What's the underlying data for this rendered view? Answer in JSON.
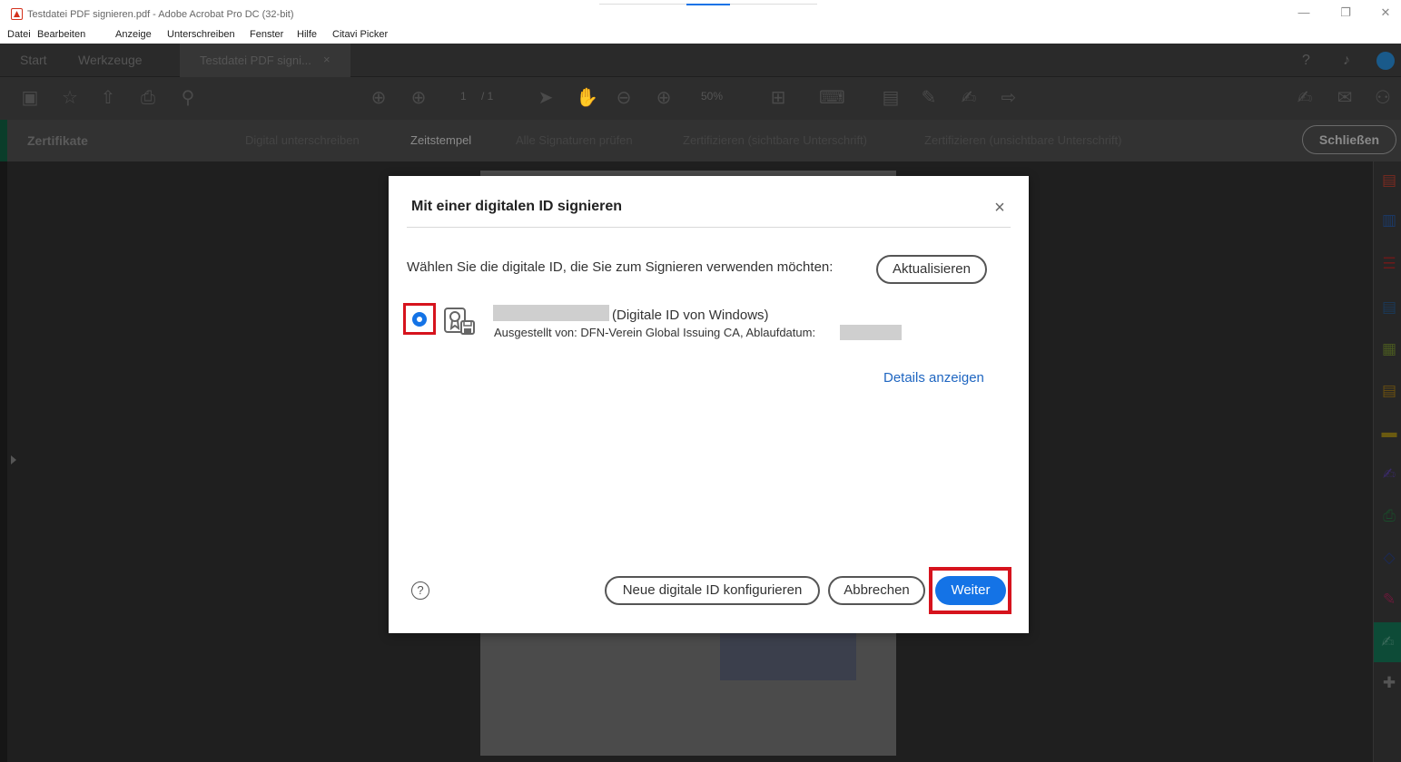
{
  "window": {
    "title": "Testdatei PDF signieren.pdf - Adobe Acrobat Pro DC (32-bit)",
    "minimize_glyph": "—",
    "restore_glyph": "❐",
    "close_glyph": "✕"
  },
  "menu": {
    "items": [
      "Datei",
      "Bearbeiten",
      "Anzeige",
      "Unterschreiben",
      "Fenster",
      "Hilfe",
      "Citavi Picker"
    ]
  },
  "tabs": {
    "start": "Start",
    "tools": "Werkzeuge",
    "document": "Testdatei PDF signi...",
    "document_close": "×"
  },
  "toolbar": {
    "page_current": "1",
    "page_total": "/ 1",
    "zoom": "50%"
  },
  "cert_bar": {
    "label": "Zertifikate",
    "actions": [
      "Digital unterschreiben",
      "Zeitstempel",
      "Alle Signaturen prüfen",
      "Zertifizieren (sichtbare Unterschrift)",
      "Zertifizieren (unsichtbare Unterschrift)"
    ],
    "close_label": "Schließen"
  },
  "dialog": {
    "title": "Mit einer digitalen ID signieren",
    "close_glyph": "×",
    "prompt": "Wählen Sie die digitale ID, die Sie zum Signieren verwenden möchten:",
    "refresh_label": "Aktualisieren",
    "id_entry": {
      "type": "(Digitale ID von Windows)",
      "issuer": "Ausgestellt von: DFN-Verein Global Issuing CA, Ablaufdatum:",
      "selected": true
    },
    "details_link": "Details anzeigen",
    "help_glyph": "?",
    "new_id_label": "Neue digitale ID konfigurieren",
    "cancel_label": "Abbrechen",
    "next_label": "Weiter"
  },
  "colors": {
    "accent": "#1473e6",
    "highlight": "#d6131d",
    "link": "#1f66c1"
  }
}
